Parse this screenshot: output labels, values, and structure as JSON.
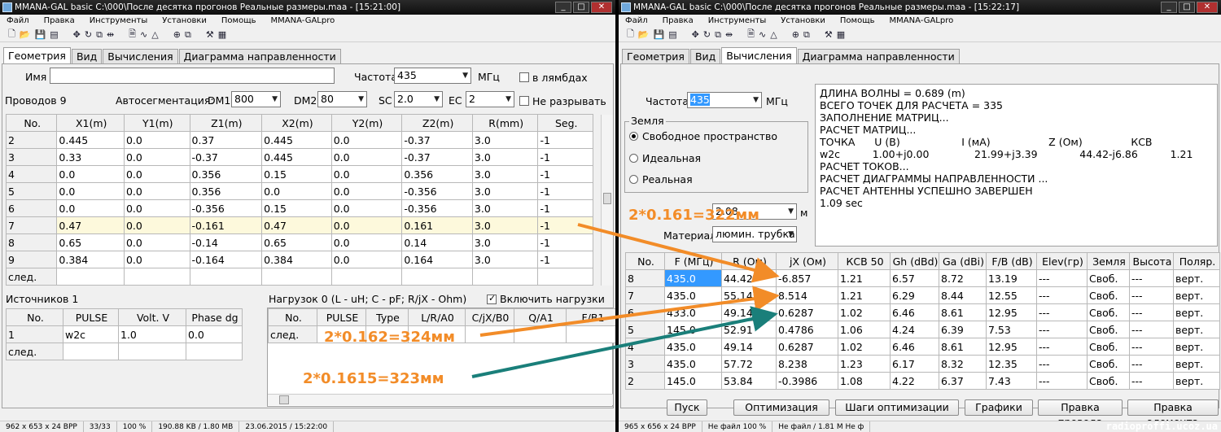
{
  "left_window": {
    "title": "MMANA-GAL basic C:\\000\\После десятка прогонов Реальные размеры.maa - [15:21:00]",
    "menu": [
      "Файл",
      "Правка",
      "Инструменты",
      "Установки",
      "Помощь",
      "MMANA-GALpro"
    ],
    "tabs": [
      "Геометрия",
      "Вид",
      "Вычисления",
      "Диаграмма направленности"
    ],
    "active_tab": "Геометрия",
    "name_label": "Имя",
    "name_value": "",
    "freq_label": "Частота",
    "freq_value": "435",
    "freq_unit": "МГц",
    "lambda_label": "в лямбдах",
    "wires_label": "Проводов 9",
    "autoseg_label": "Автосегментация:",
    "dm1_label": "DM1",
    "dm1_value": "800",
    "dm2_label": "DM2",
    "dm2_value": "80",
    "sc_label": "SC",
    "sc_value": "2.0",
    "ec_label": "EC",
    "ec_value": "2",
    "nobreak_label": "Не разрывать",
    "wire_table": {
      "headers": [
        "No.",
        "X1(m)",
        "Y1(m)",
        "Z1(m)",
        "X2(m)",
        "Y2(m)",
        "Z2(m)",
        "R(mm)",
        "Seg."
      ],
      "rows": [
        [
          "2",
          "0.445",
          "0.0",
          "0.37",
          "0.445",
          "0.0",
          "-0.37",
          "3.0",
          "-1"
        ],
        [
          "3",
          "0.33",
          "0.0",
          "-0.37",
          "0.445",
          "0.0",
          "-0.37",
          "3.0",
          "-1"
        ],
        [
          "4",
          "0.0",
          "0.0",
          "0.356",
          "0.15",
          "0.0",
          "0.356",
          "3.0",
          "-1"
        ],
        [
          "5",
          "0.0",
          "0.0",
          "0.356",
          "0.0",
          "0.0",
          "-0.356",
          "3.0",
          "-1"
        ],
        [
          "6",
          "0.0",
          "0.0",
          "-0.356",
          "0.15",
          "0.0",
          "-0.356",
          "3.0",
          "-1"
        ],
        [
          "7",
          "0.47",
          "0.0",
          "-0.161",
          "0.47",
          "0.0",
          "0.161",
          "3.0",
          "-1"
        ],
        [
          "8",
          "0.65",
          "0.0",
          "-0.14",
          "0.65",
          "0.0",
          "0.14",
          "3.0",
          "-1"
        ],
        [
          "9",
          "0.384",
          "0.0",
          "-0.164",
          "0.384",
          "0.0",
          "0.164",
          "3.0",
          "-1"
        ],
        [
          "след.",
          "",
          "",
          "",
          "",
          "",
          "",
          "",
          ""
        ]
      ]
    },
    "sources_label": "Источников 1",
    "sources_table": {
      "headers": [
        "No.",
        "PULSE",
        "Volt. V",
        "Phase dg"
      ],
      "rows": [
        [
          "1",
          "w2c",
          "1.0",
          "0.0"
        ],
        [
          "след.",
          "",
          "",
          ""
        ]
      ]
    },
    "loads_label": "Нагрузок 0 (L - uH; C - pF; R/jX - Ohm)",
    "enable_loads_label": "Включить нагрузки",
    "loads_table": {
      "headers": [
        "No.",
        "PULSE",
        "Type",
        "L/R/A0",
        "C/jX/B0",
        "Q/A1",
        "F/B1"
      ],
      "rows": [
        [
          "след.",
          "",
          "",
          "",
          "",
          "",
          ""
        ]
      ]
    },
    "status": [
      "962 x 653 x 24 BPP",
      "33/33",
      "100 %",
      "190.88 KB / 1.80 MB",
      "23.06.2015 / 15:22:00"
    ]
  },
  "right_window": {
    "title": "MMANA-GAL basic C:\\000\\После десятка прогонов Реальные размеры.maa - [15:22:17]",
    "menu": [
      "Файл",
      "Правка",
      "Инструменты",
      "Установки",
      "Помощь",
      "MMANA-GALpro"
    ],
    "tabs": [
      "Геометрия",
      "Вид",
      "Вычисления",
      "Диаграмма направленности"
    ],
    "active_tab": "Вычисления",
    "freq_label": "Частота",
    "freq_value": "435",
    "freq_unit": "МГц",
    "ground_label": "Земля",
    "ground_options": [
      "Свободное пространство",
      "Идеальная",
      "Реальная"
    ],
    "height_value": "2.08",
    "height_unit": "м",
    "material_label": "Материал",
    "material_value": "люмин. трубка",
    "results_lines": [
      "ДЛИНА ВОЛНЫ = 0.689 (m)",
      "ВСЕГО ТОЧЕК ДЛЯ РАСЧЕТА = 335",
      "ЗАПОЛНЕНИЕ МАТРИЦ...",
      "РАСЧЕТ МАТРИЦ...",
      "ТОЧКА      U (В)                   I (мА)                  Z (Ом)               КСВ",
      "w2c          1.00+j0.00              21.99+j3.39             44.42-j6.86          1.21",
      "РАСЧЕТ ТОКОВ...",
      "РАСЧЕТ ДИАГРАММЫ НАПРАВЛЕННОСТИ ...",
      "РАСЧЕТ АНТЕННЫ УСПЕШНО ЗАВЕРШЕН",
      "1.09 sec"
    ],
    "calc_table": {
      "headers": [
        "No.",
        "F (МГц)",
        "R (Ом)",
        "jX (Ом)",
        "КСВ 50",
        "Gh (dBd)",
        "Ga (dBi)",
        "F/B (dB)",
        "Elev(гр)",
        "Земля",
        "Высота",
        "Поляр."
      ],
      "rows": [
        [
          "8",
          "435.0",
          "44.42",
          "-6.857",
          "1.21",
          "6.57",
          "8.72",
          "13.19",
          "---",
          "Своб.",
          "---",
          "верт."
        ],
        [
          "7",
          "435.0",
          "55.14",
          "8.514",
          "1.21",
          "6.29",
          "8.44",
          "12.55",
          "---",
          "Своб.",
          "---",
          "верт."
        ],
        [
          "6",
          "433.0",
          "49.14",
          "0.6287",
          "1.02",
          "6.46",
          "8.61",
          "12.95",
          "---",
          "Своб.",
          "---",
          "верт."
        ],
        [
          "5",
          "145.0",
          "52.91",
          "0.4786",
          "1.06",
          "4.24",
          "6.39",
          "7.53",
          "---",
          "Своб.",
          "---",
          "верт."
        ],
        [
          "4",
          "435.0",
          "49.14",
          "0.6287",
          "1.02",
          "6.46",
          "8.61",
          "12.95",
          "---",
          "Своб.",
          "---",
          "верт."
        ],
        [
          "3",
          "435.0",
          "57.72",
          "8.238",
          "1.23",
          "6.17",
          "8.32",
          "12.35",
          "---",
          "Своб.",
          "---",
          "верт."
        ],
        [
          "2",
          "145.0",
          "53.84",
          "-0.3986",
          "1.08",
          "4.22",
          "6.37",
          "7.43",
          "---",
          "Своб.",
          "---",
          "верт."
        ]
      ]
    },
    "buttons": [
      "Пуск",
      "Оптимизация",
      "Шаги оптимизации",
      "Графики",
      "Правка провода",
      "Правка элемента"
    ],
    "status": [
      "965 x 656 x 24 BPP",
      "Не файл 100 %",
      "Не файл / 1.81 M Не ф"
    ]
  },
  "annotations": {
    "a1": "2*0.161=322мм",
    "a2": "2*0.162=324мм",
    "a3": "2*0.1615=323мм",
    "color_orange": "#f28c28",
    "color_teal": "#1a7f7a"
  },
  "watermark": "radioproffi.ucoz.ua"
}
